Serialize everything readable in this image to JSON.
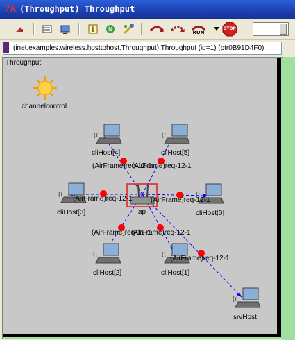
{
  "window": {
    "title": "(Throughput) Throughput"
  },
  "toolbar": {
    "buttons": [
      {
        "name": "step-back",
        "icon": "rewind-arrow-icon"
      },
      {
        "name": "object-tree",
        "icon": "tree-list-icon"
      },
      {
        "name": "inspect-window",
        "icon": "window-icon"
      },
      {
        "name": "info",
        "icon": "info-icon"
      },
      {
        "name": "network",
        "icon": "network-icon"
      },
      {
        "name": "tools",
        "icon": "tools-icon"
      },
      {
        "name": "step",
        "icon": "step-icon"
      },
      {
        "name": "run",
        "icon": "run-icon"
      },
      {
        "name": "fast-run",
        "icon": "fast-run-icon"
      },
      {
        "name": "express-run",
        "icon": "express-run-icon",
        "label": "RUN"
      },
      {
        "name": "run-menu",
        "icon": "dropdown-arrow-icon"
      },
      {
        "name": "stop",
        "icon": "stop-icon",
        "label": "STOP"
      }
    ]
  },
  "infobar": {
    "text": "(inet.examples.wireless.hosttohost.Throughput) Throughput  (id=1)  (ptr0B91D4F0)"
  },
  "network": {
    "title": "Throughput",
    "modules": [
      {
        "name": "channelcontrol"
      },
      {
        "name": "cliHost[4]"
      },
      {
        "name": "cliHost[5]"
      },
      {
        "name": "cliHost[3]"
      },
      {
        "name": "ap"
      },
      {
        "name": "cliHost[0]"
      },
      {
        "name": "cliHost[2]"
      },
      {
        "name": "cliHost[1]"
      },
      {
        "name": "srvHost"
      }
    ],
    "message_label": "(AirFrame)req-12-1"
  },
  "colors": {
    "message_dot": "#ff0000",
    "message_line": "#0000ff",
    "title_bar": "#1c3fb0",
    "canvas_border": "#a0dfa0"
  }
}
